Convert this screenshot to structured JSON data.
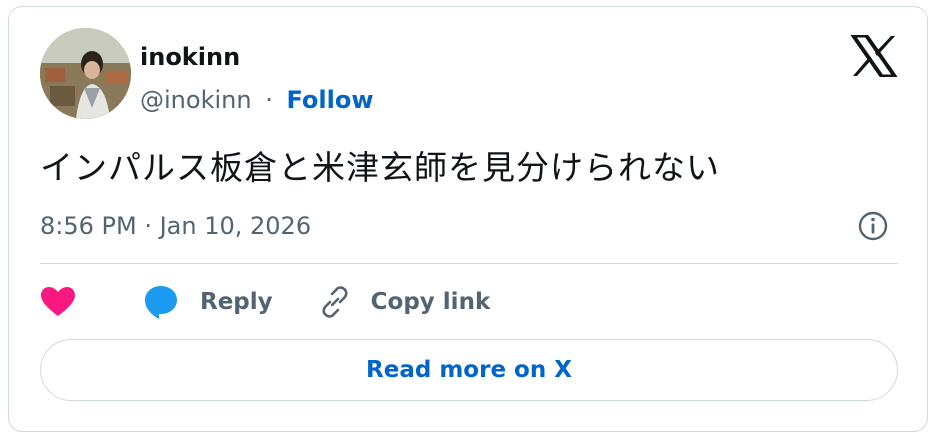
{
  "author": {
    "name": "inokinn",
    "handle": "@inokinn",
    "separator": "·",
    "follow_label": "Follow"
  },
  "tweet": {
    "text": "インパルス板倉と米津玄師を見分けられない",
    "timestamp": "8:56 PM · Jan 10, 2026"
  },
  "actions": {
    "reply_label": "Reply",
    "copy_link_label": "Copy link"
  },
  "read_more_label": "Read more on X",
  "colors": {
    "accent": "#0064ca",
    "like": "#f91880",
    "reply": "#1d9bf0",
    "secondary_text": "#536471",
    "border": "#cfd9de"
  },
  "icons": {
    "brand": "x-logo-icon",
    "info": "info-icon",
    "like": "heart-icon",
    "reply": "speech-bubble-icon",
    "copy_link": "link-icon"
  }
}
